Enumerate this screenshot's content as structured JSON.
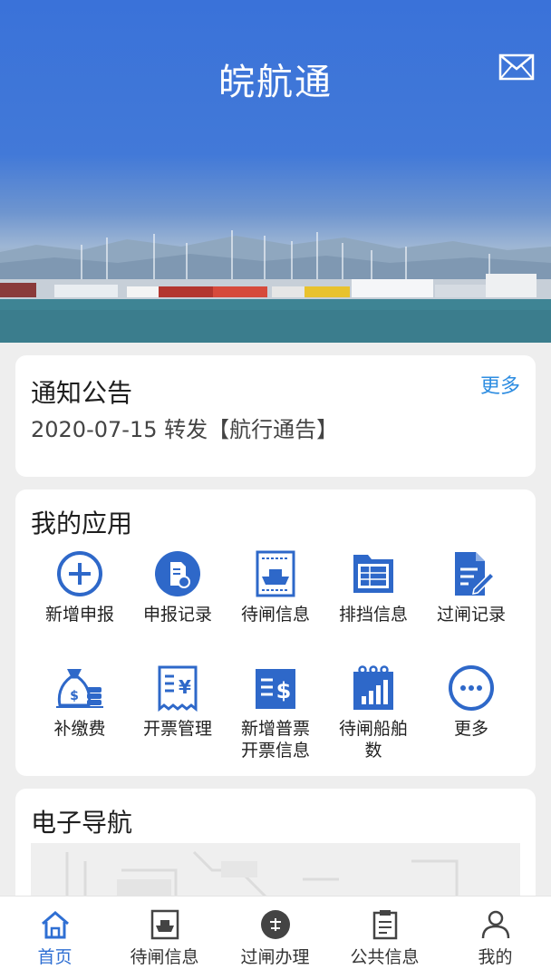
{
  "header": {
    "title": "皖航通"
  },
  "notice": {
    "title": "通知公告",
    "more_label": "更多",
    "latest": "2020-07-15 转发【航行通告】"
  },
  "apps": {
    "title": "我的应用",
    "items": [
      {
        "label": "新增申报",
        "icon": "plus-circle-icon"
      },
      {
        "label": "申报记录",
        "icon": "record-document-icon"
      },
      {
        "label": "待闸信息",
        "icon": "ship-lock-icon"
      },
      {
        "label": "排挡信息",
        "icon": "folder-grid-icon"
      },
      {
        "label": "过闸记录",
        "icon": "document-edit-icon"
      },
      {
        "label": "补缴费",
        "icon": "money-bag-icon"
      },
      {
        "label": "开票管理",
        "icon": "invoice-icon"
      },
      {
        "label": "新增普票",
        "label2": "开票信息",
        "icon": "invoice-dollar-icon"
      },
      {
        "label": "待闸船舶",
        "label2": "数",
        "icon": "calendar-chart-icon"
      },
      {
        "label": "更多",
        "icon": "more-circle-icon"
      }
    ]
  },
  "nav": {
    "title": "电子导航"
  },
  "tabbar": {
    "items": [
      {
        "label": "首页",
        "icon": "home-icon",
        "active": true
      },
      {
        "label": "待闸信息",
        "icon": "ship-lock-icon",
        "active": false
      },
      {
        "label": "过闸办理",
        "icon": "process-icon",
        "active": false
      },
      {
        "label": "公共信息",
        "icon": "clipboard-icon",
        "active": false
      },
      {
        "label": "我的",
        "icon": "user-icon",
        "active": false
      }
    ]
  },
  "colors": {
    "primary": "#2f6fd3",
    "icon_blue": "#2e68c9",
    "link": "#2e8de1"
  }
}
